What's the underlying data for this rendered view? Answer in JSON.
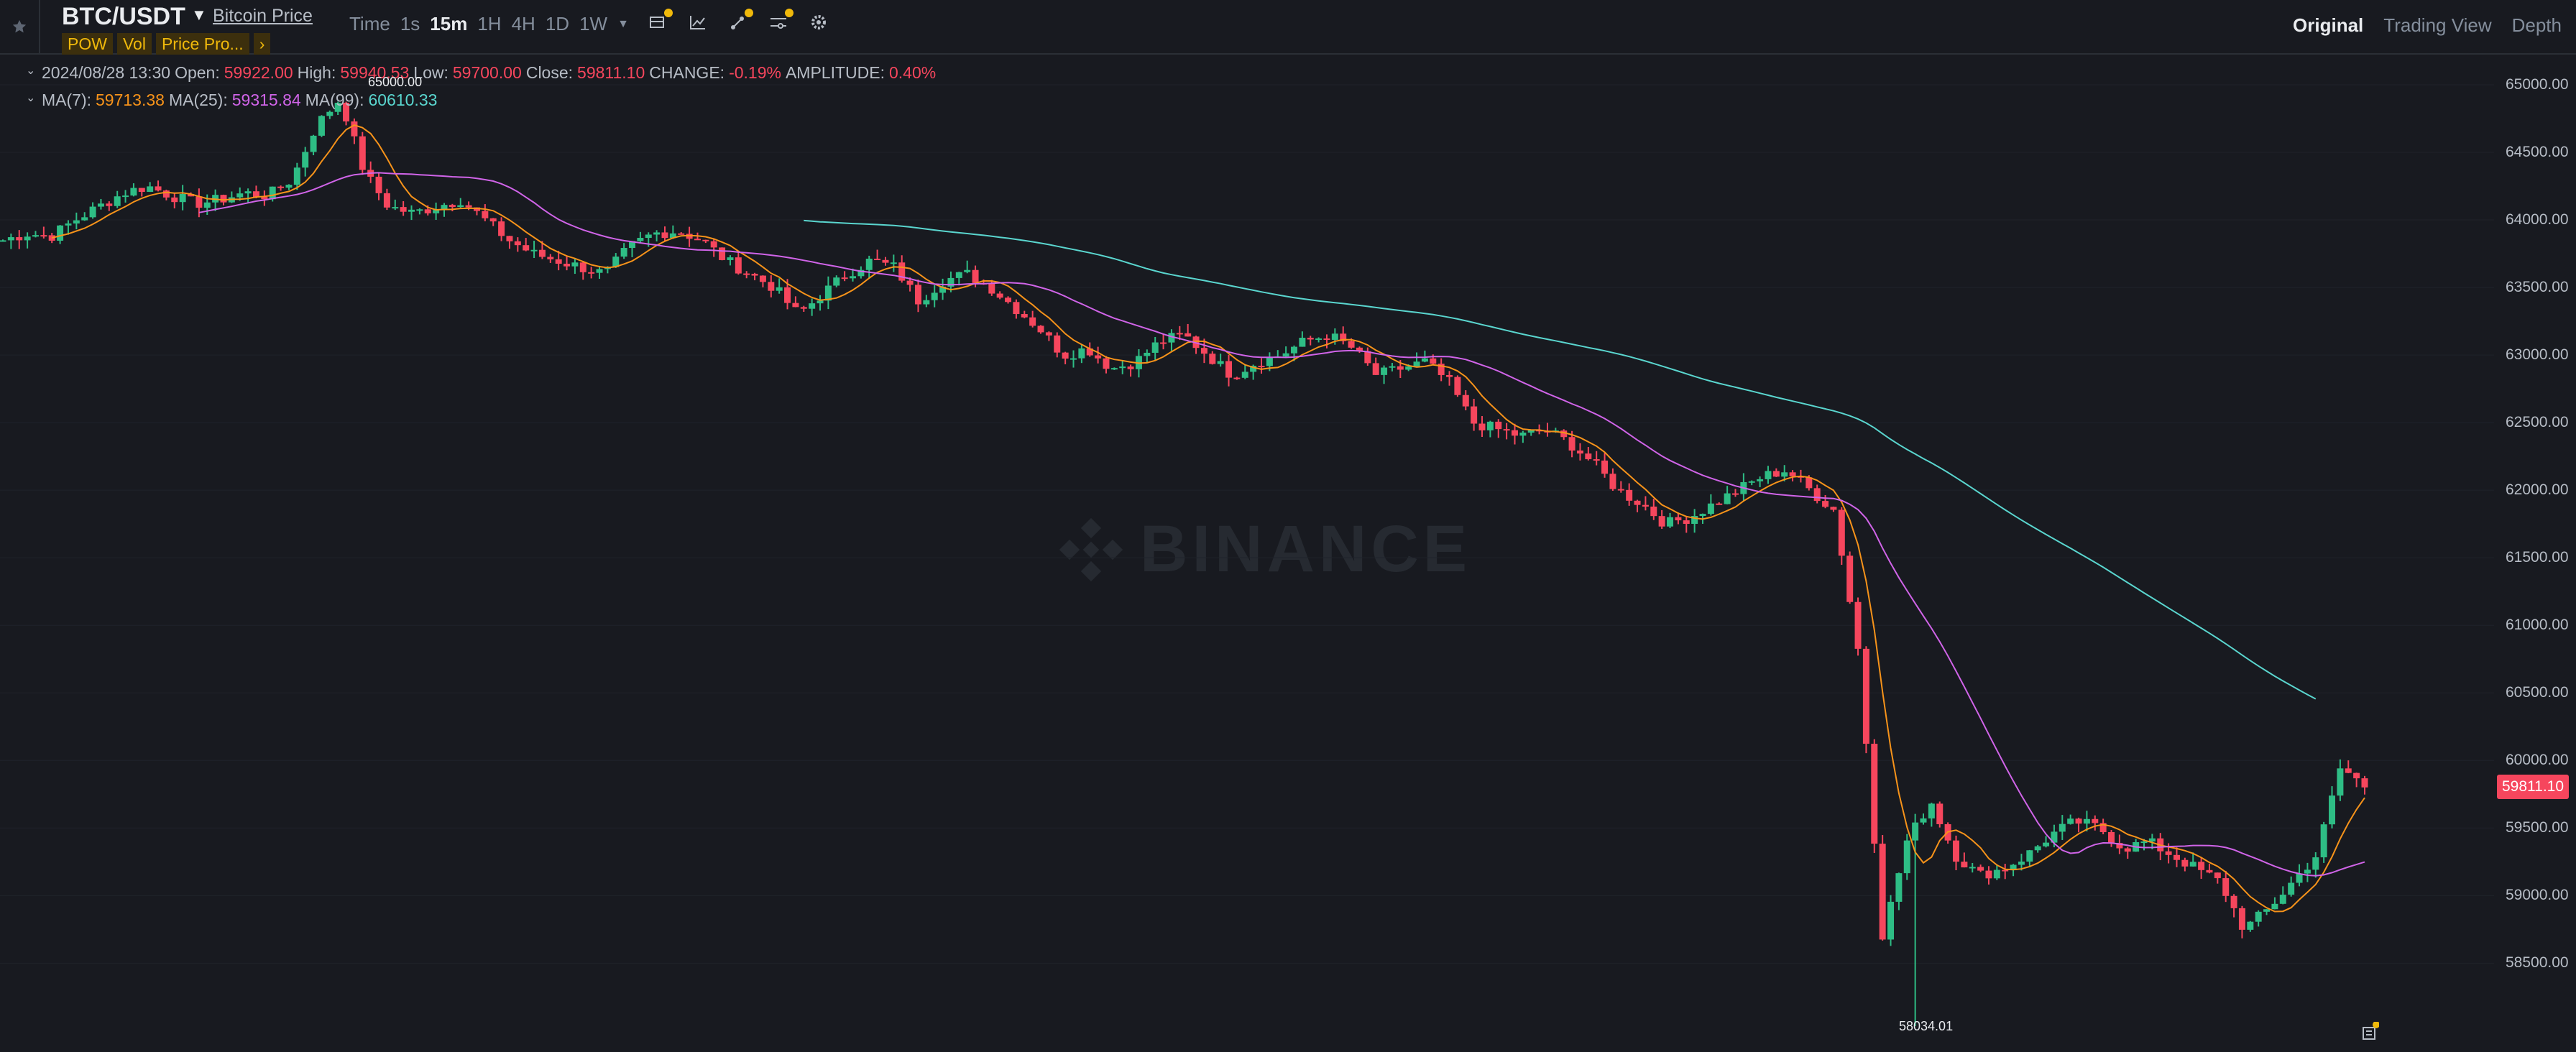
{
  "header": {
    "pair": "BTC/USDT",
    "price_link": "Bitcoin Price",
    "tags": [
      "POW",
      "Vol",
      "Price Pro...",
      "›"
    ],
    "intervals": [
      "Time",
      "1s",
      "15m",
      "1H",
      "4H",
      "1D",
      "1W"
    ],
    "active_interval": "15m",
    "tool_icons": [
      "indicators-icon",
      "chart-type-icon",
      "drawing-tools-icon",
      "layout-icon",
      "settings-icon"
    ],
    "views": [
      "Original",
      "Trading View",
      "Depth"
    ],
    "active_view": "Original"
  },
  "legend": {
    "date": "2024/08/28 13:30",
    "open_label": "Open:",
    "open": "59922.00",
    "high_label": "High:",
    "high": "59940.53",
    "low_label": "Low:",
    "low": "59700.00",
    "close_label": "Close:",
    "close": "59811.10",
    "change_label": "CHANGE:",
    "change": "-0.19%",
    "amp_label": "AMPLITUDE:",
    "amp": "0.40%",
    "ma7_label": "MA(7):",
    "ma7": "59713.38",
    "ma25_label": "MA(25):",
    "ma25": "59315.84",
    "ma99_label": "MA(99):",
    "ma99": "60610.33"
  },
  "watermark": "BINANCE",
  "current_price": "59811.10",
  "annotations": {
    "high": "65000.00",
    "low": "58034.01"
  },
  "colors": {
    "up": "#2ebd85",
    "down": "#f6465d",
    "ma7": "#f7931a",
    "ma25": "#d064e8",
    "ma99": "#5ad6cf",
    "background": "#181a20"
  },
  "chart_data": {
    "type": "candlestick",
    "y_ticks": [
      "65000.00",
      "64500.00",
      "64000.00",
      "63500.00",
      "63000.00",
      "62500.00",
      "62000.00",
      "61500.00",
      "61000.00",
      "60500.00",
      "60000.00",
      "59500.00",
      "59000.00",
      "58500.00"
    ],
    "ylim": [
      58034.01,
      65000.0
    ],
    "close_path": [
      63850,
      63900,
      63880,
      64000,
      64100,
      64200,
      64250,
      64180,
      64120,
      64150,
      64200,
      64180,
      64300,
      64700,
      64900,
      64350,
      64100,
      64050,
      64100,
      64150,
      64000,
      63850,
      63750,
      63700,
      63650,
      63600,
      63800,
      63900,
      63920,
      63850,
      63700,
      63600,
      63500,
      63300,
      63450,
      63600,
      63700,
      63650,
      63400,
      63550,
      63600,
      63500,
      63350,
      63200,
      63000,
      63050,
      62900,
      62950,
      63100,
      63150,
      63000,
      62850,
      62950,
      63000,
      63100,
      63150,
      63050,
      62850,
      62900,
      62950,
      62800,
      62500,
      62450,
      62400,
      62450,
      62350,
      62200,
      62000,
      61900,
      61750,
      61800,
      61900,
      62000,
      62100,
      62150,
      62000,
      61850,
      60800,
      58700,
      59400,
      59700,
      59300,
      59150,
      59200,
      59300,
      59450,
      59550,
      59500,
      59350,
      59400,
      59300,
      59200,
      59100,
      58750,
      58900,
      59100,
      59300,
      59950,
      59811
    ],
    "ma7": "overlay line, follows price closely",
    "ma25": "overlay line, smoother",
    "ma99": "overlay line, long-term downward curve"
  }
}
